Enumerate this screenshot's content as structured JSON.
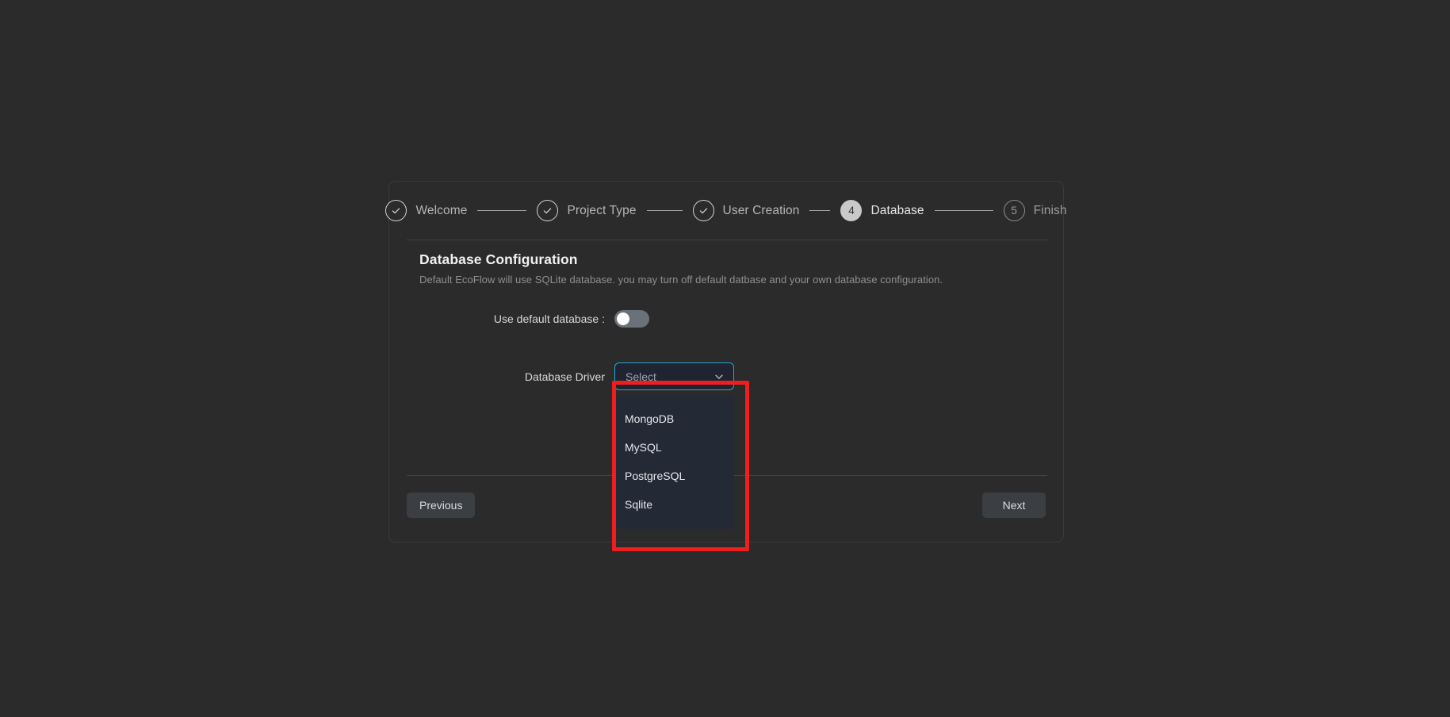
{
  "stepper": {
    "steps": [
      {
        "label": "Welcome",
        "marker": "check",
        "state": "done"
      },
      {
        "label": "Project Type",
        "marker": "check",
        "state": "done"
      },
      {
        "label": "User Creation",
        "marker": "check",
        "state": "done"
      },
      {
        "label": "Database",
        "marker": "4",
        "state": "active"
      },
      {
        "label": "Finish",
        "marker": "5",
        "state": "pending"
      }
    ]
  },
  "section": {
    "title": "Database Configuration",
    "description": "Default EcoFlow will use SQLite database. you may turn off default datbase and your own database configuration."
  },
  "form": {
    "default_database": {
      "label": "Use default database :",
      "toggle_state": "off"
    },
    "database_driver": {
      "label": "Database Driver",
      "placeholder": "Select",
      "selected_value": "Select",
      "chevron_icon": "chevron-down-icon",
      "expanded": true,
      "options": [
        "MongoDB",
        "MySQL",
        "PostgreSQL",
        "Sqlite"
      ]
    }
  },
  "footer": {
    "previous_label": "Previous",
    "next_label": "Next"
  },
  "annotation": {
    "color": "#f01f1f",
    "target": "database-driver-dropdown"
  },
  "colors": {
    "page_background": "#2b2b2b",
    "card_background": "#2b2b2b",
    "accent_focus": "#26a7d4",
    "annotation_red": "#f01f1f",
    "dropdown_background": "#242936",
    "button_background": "#3b3f43"
  }
}
